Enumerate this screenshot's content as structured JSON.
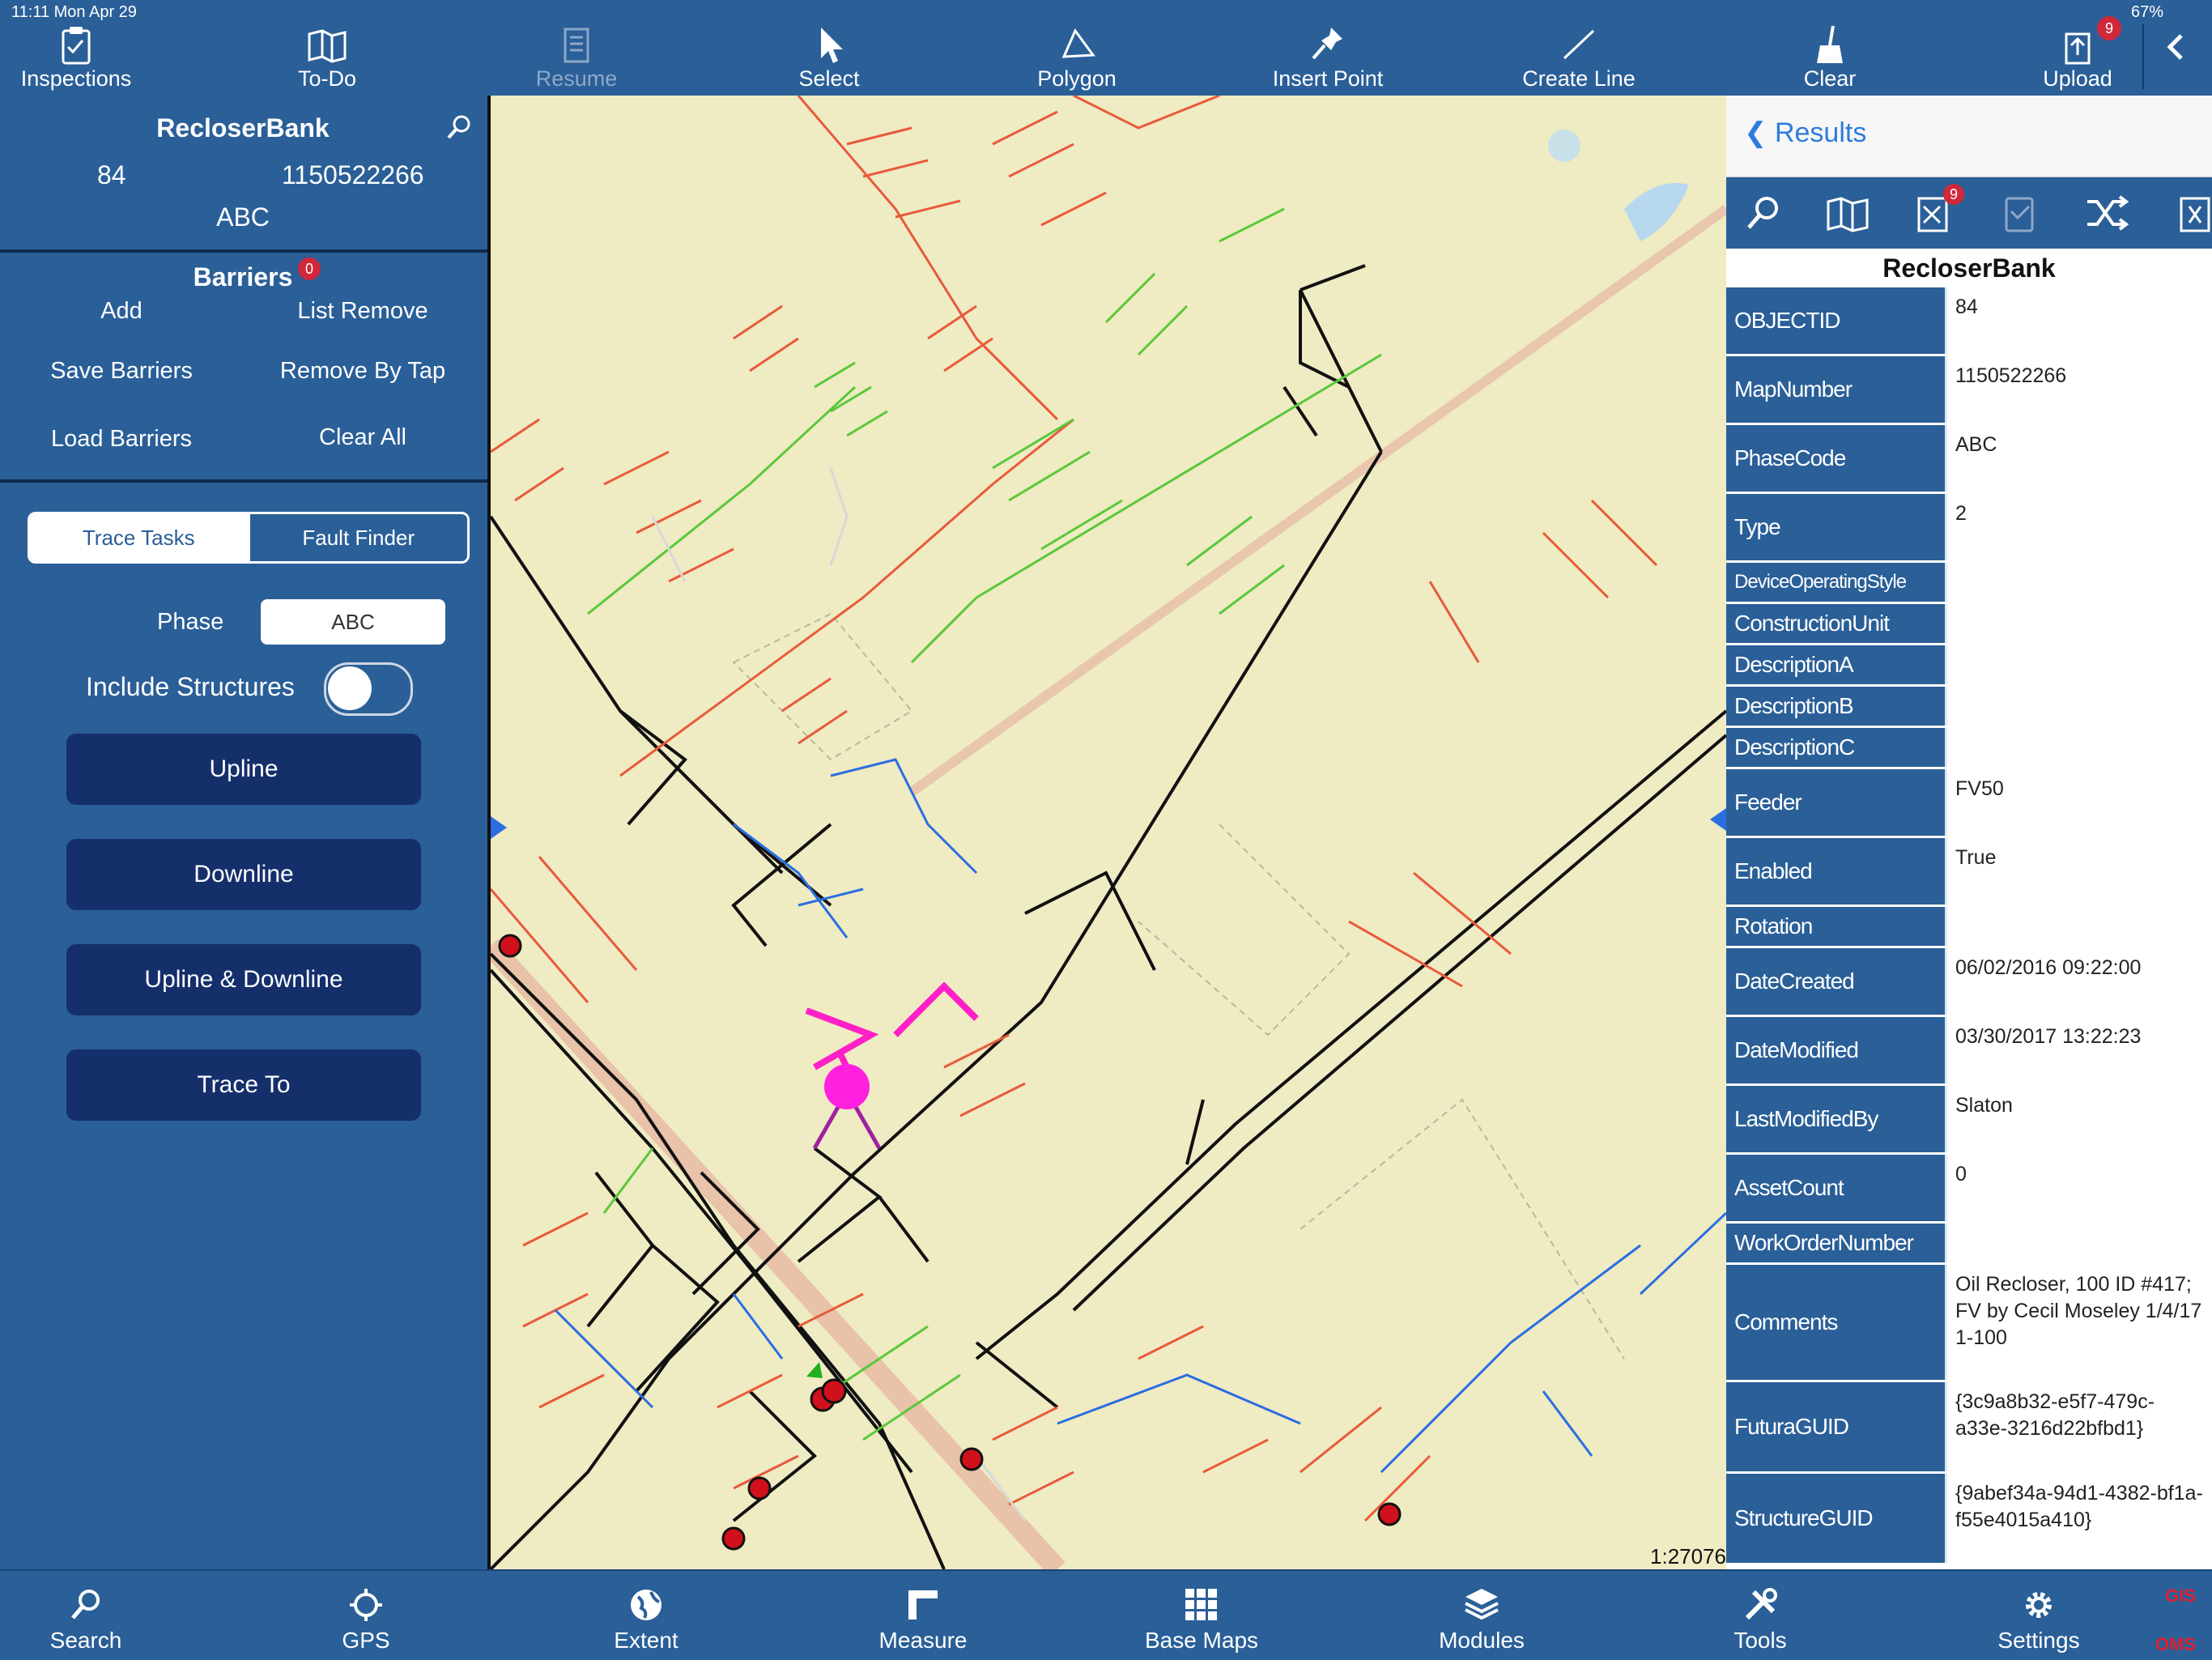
{
  "status": {
    "time": "11:11  Mon Apr 29",
    "battery": "67%"
  },
  "toolbar": {
    "items": [
      {
        "label": "Inspections",
        "icon": "clipboard-icon"
      },
      {
        "label": "To-Do",
        "icon": "book-map-icon"
      },
      {
        "label": "Resume",
        "icon": "document-icon"
      },
      {
        "label": "Select",
        "icon": "cursor-icon"
      },
      {
        "label": "Polygon",
        "icon": "polygon-icon"
      },
      {
        "label": "Insert Point",
        "icon": "pin-icon"
      },
      {
        "label": "Create Line",
        "icon": "line-icon"
      },
      {
        "label": "Clear",
        "icon": "broom-icon"
      },
      {
        "label": "Upload",
        "icon": "upload-icon",
        "badge": "9"
      }
    ]
  },
  "feature": {
    "name": "RecloserBank",
    "objectid": "84",
    "map_number": "1150522266",
    "phase": "ABC"
  },
  "barriers": {
    "title": "Barriers",
    "count": "0",
    "add": "Add",
    "list_remove": "List Remove",
    "save": "Save Barriers",
    "remove_by_tap": "Remove By Tap",
    "load": "Load Barriers",
    "clear_all": "Clear All"
  },
  "tabs": {
    "trace_tasks": "Trace Tasks",
    "fault_finder": "Fault Finder"
  },
  "trace": {
    "phase_label": "Phase",
    "phase_value": "ABC",
    "include_structures": "Include Structures",
    "include_structures_on": false,
    "upline": "Upline",
    "downline": "Downline",
    "upline_downline": "Upline & Downline",
    "trace_to": "Trace To"
  },
  "map": {
    "scale": "1:27076"
  },
  "results": {
    "back": "Results",
    "title": "RecloserBank",
    "tool_badge": "9",
    "attributes": [
      {
        "key": "OBJECTID",
        "value": "84"
      },
      {
        "key": "MapNumber",
        "value": "1150522266"
      },
      {
        "key": "PhaseCode",
        "value": "ABC"
      },
      {
        "key": "Type",
        "value": "2"
      },
      {
        "key": "DeviceOperatingStyle",
        "value": ""
      },
      {
        "key": "ConstructionUnit",
        "value": ""
      },
      {
        "key": "DescriptionA",
        "value": ""
      },
      {
        "key": "DescriptionB",
        "value": ""
      },
      {
        "key": "DescriptionC",
        "value": ""
      },
      {
        "key": "Feeder",
        "value": "FV50"
      },
      {
        "key": "Enabled",
        "value": "True"
      },
      {
        "key": "Rotation",
        "value": ""
      },
      {
        "key": "DateCreated",
        "value": "06/02/2016 09:22:00"
      },
      {
        "key": "DateModified",
        "value": "03/30/2017 13:22:23"
      },
      {
        "key": "LastModifiedBy",
        "value": "Slaton"
      },
      {
        "key": "AssetCount",
        "value": "0"
      },
      {
        "key": "WorkOrderNumber",
        "value": ""
      },
      {
        "key": "Comments",
        "value": "Oil Recloser, 100 ID #417; FV by Cecil Moseley 1/4/17 1-100"
      },
      {
        "key": "FuturaGUID",
        "value": "{3c9a8b32-e5f7-479c-a33e-3216d22bfbd1}"
      },
      {
        "key": "StructureGUID",
        "value": "{9abef34a-94d1-4382-bf1a-f55e4015a410}"
      }
    ]
  },
  "bottombar": {
    "items": [
      {
        "label": "Search",
        "icon": "search-icon"
      },
      {
        "label": "GPS",
        "icon": "gps-icon"
      },
      {
        "label": "Extent",
        "icon": "globe-icon"
      },
      {
        "label": "Measure",
        "icon": "ruler-icon"
      },
      {
        "label": "Base Maps",
        "icon": "grid-icon"
      },
      {
        "label": "Modules",
        "icon": "layers-icon"
      },
      {
        "label": "Tools",
        "icon": "tools-icon"
      },
      {
        "label": "Settings",
        "icon": "gear-icon"
      }
    ],
    "gis": "GIS",
    "oms": "OMS"
  }
}
